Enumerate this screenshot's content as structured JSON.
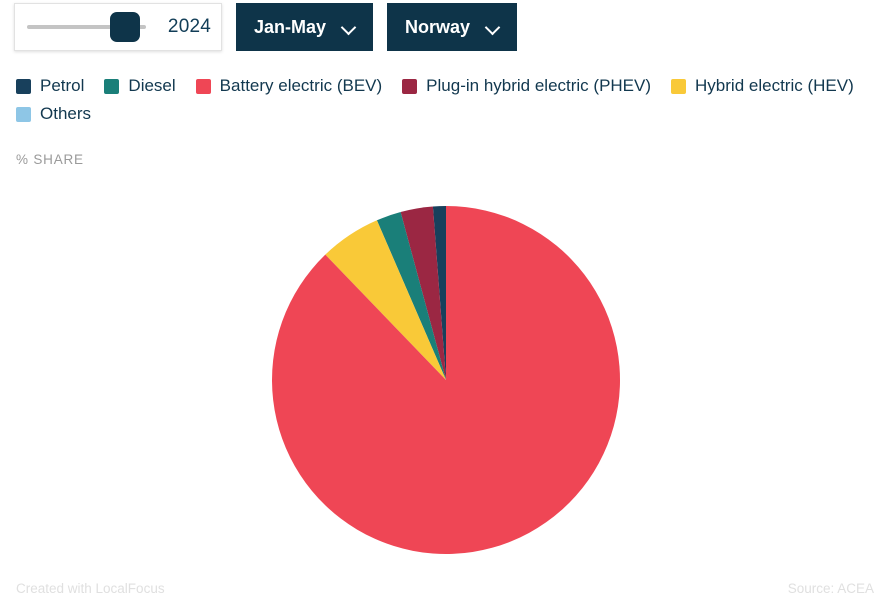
{
  "controls": {
    "year_slider": {
      "value": "2024",
      "fill_percent": 88
    },
    "period_dropdown": {
      "label": "Jan-May",
      "icon": "chevron-down-icon"
    },
    "country_dropdown": {
      "label": "Norway",
      "icon": "chevron-down-icon"
    }
  },
  "axis_label": "% SHARE",
  "footer": {
    "left": "Created with LocalFocus",
    "right": "Source: ACEA"
  },
  "chart_data": {
    "type": "pie",
    "title": "",
    "subtitle": "",
    "xlabel": "",
    "ylabel": "% SHARE",
    "legend_position": "top",
    "start_angle_deg": 0,
    "direction": "counterclockwise",
    "categories": [
      "Petrol",
      "Diesel",
      "Battery electric (BEV)",
      "Plug-in hybrid electric (PHEV)",
      "Hybrid electric (HEV)",
      "Others"
    ],
    "colors": [
      "#18405c",
      "#1a7f79",
      "#ef4655",
      "#9b2743",
      "#f9c938",
      "#8ec6e6"
    ],
    "values": [
      1.2,
      2.3,
      87.8,
      3.0,
      5.7,
      0.0
    ],
    "slice_order_ccw_from_top": [
      {
        "name": "Petrol",
        "value": 1.2,
        "color": "#18405c"
      },
      {
        "name": "Plug-in hybrid electric (PHEV)",
        "value": 3.0,
        "color": "#9b2743"
      },
      {
        "name": "Diesel",
        "value": 2.3,
        "color": "#1a7f79"
      },
      {
        "name": "Hybrid electric (HEV)",
        "value": 5.7,
        "color": "#f9c938"
      },
      {
        "name": "Battery electric (BEV)",
        "value": 87.8,
        "color": "#ef4655"
      }
    ]
  },
  "legend": {
    "items": [
      {
        "label": "Petrol",
        "color": "#18405c"
      },
      {
        "label": "Diesel",
        "color": "#1a7f79"
      },
      {
        "label": "Battery electric (BEV)",
        "color": "#ef4655"
      },
      {
        "label": "Plug-in hybrid electric (PHEV)",
        "color": "#9b2743"
      },
      {
        "label": "Hybrid electric (HEV)",
        "color": "#f9c938"
      },
      {
        "label": "Others",
        "color": "#8ec6e6"
      }
    ]
  }
}
